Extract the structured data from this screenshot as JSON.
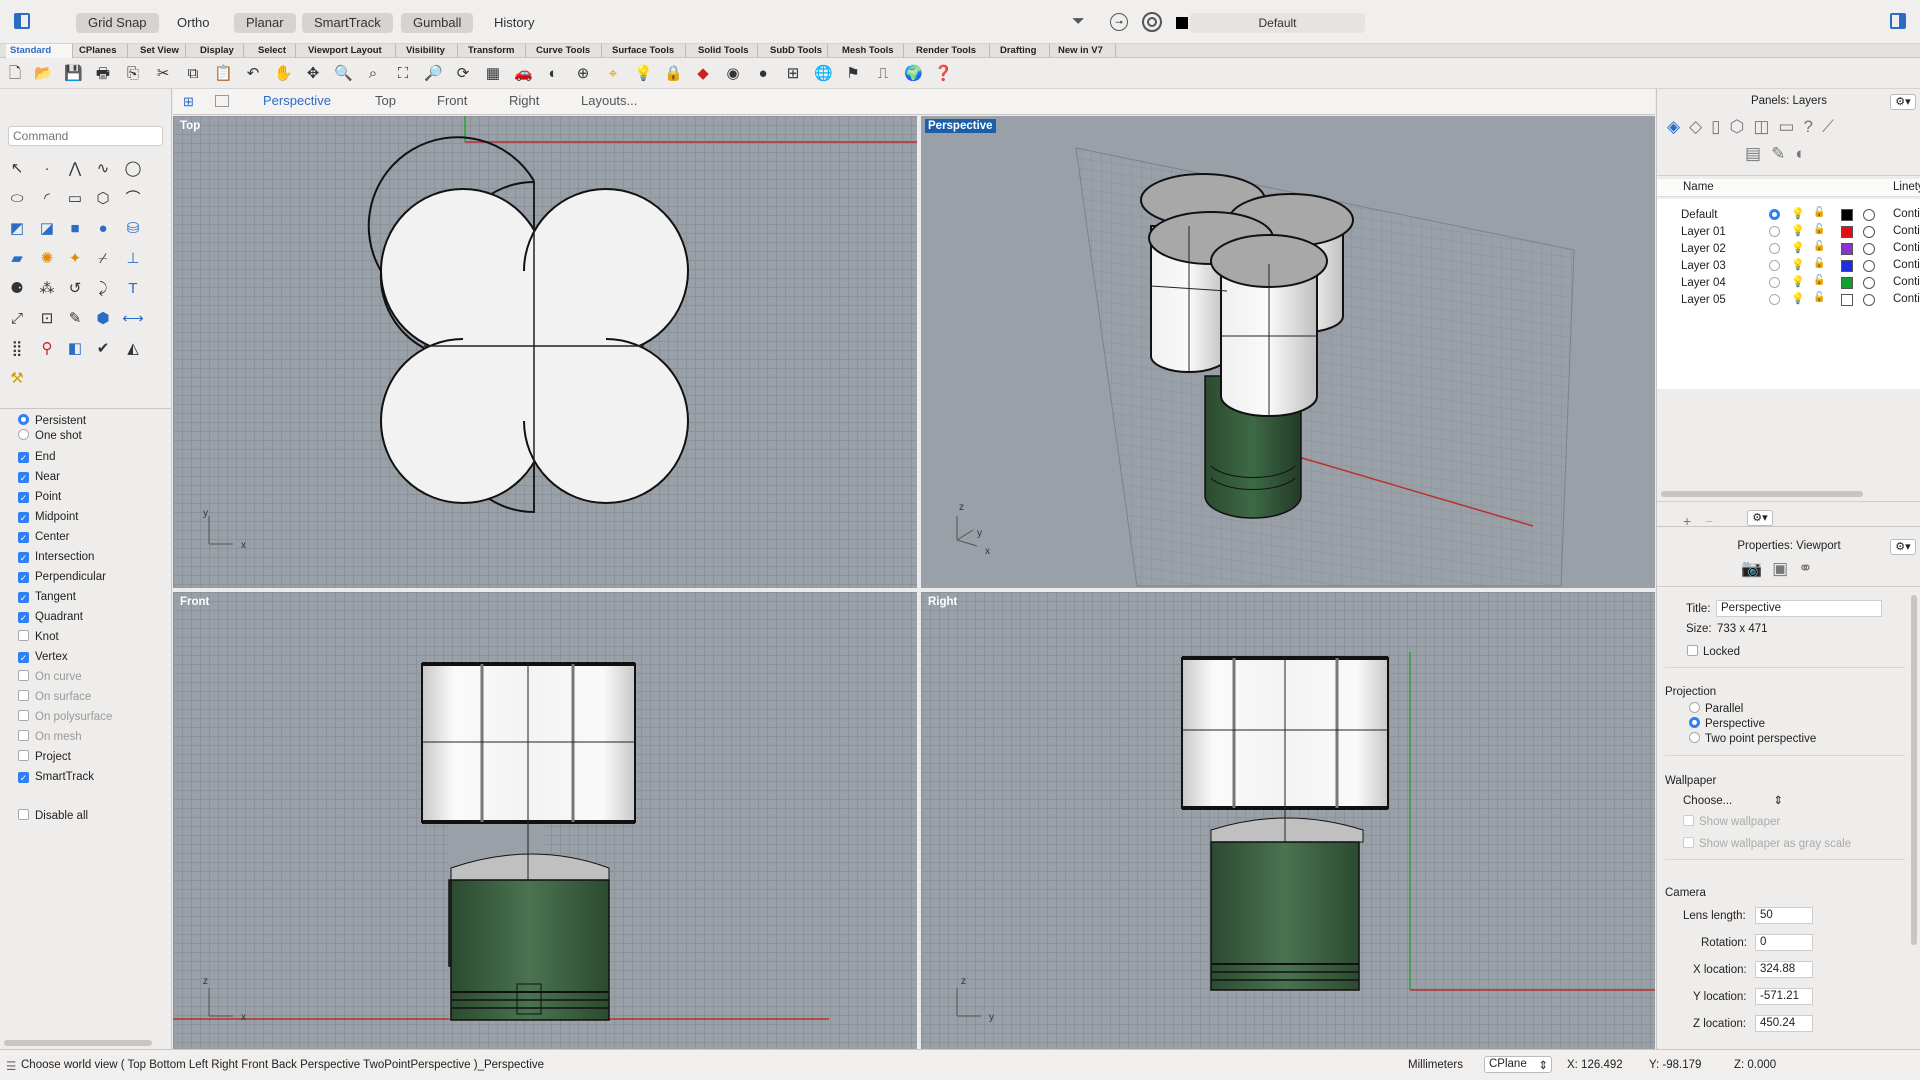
{
  "toolbar": {
    "grid_snap": "Grid Snap",
    "ortho": "Ortho",
    "planar": "Planar",
    "smarttrack": "SmartTrack",
    "gumball": "Gumball",
    "history": "History",
    "current_layer": "Default"
  },
  "tabs": [
    "Standard",
    "CPlanes",
    "Set View",
    "Display",
    "Select",
    "Viewport Layout",
    "Visibility",
    "Transform",
    "Curve Tools",
    "Surface Tools",
    "Solid Tools",
    "SubD Tools",
    "Mesh Tools",
    "Render Tools",
    "Drafting",
    "New in V7"
  ],
  "command": {
    "placeholder": "Command"
  },
  "viewport_tabs": {
    "perspective": "Perspective",
    "top": "Top",
    "front": "Front",
    "right": "Right",
    "layouts": "Layouts..."
  },
  "viewports": {
    "top": "Top",
    "perspective": "Perspective",
    "front": "Front",
    "right": "Right"
  },
  "axes": {
    "x": "x",
    "y": "y",
    "z": "z"
  },
  "osnap": {
    "persistent": "Persistent",
    "one_shot": "One shot",
    "items": [
      {
        "label": "End",
        "checked": true
      },
      {
        "label": "Near",
        "checked": true
      },
      {
        "label": "Point",
        "checked": true
      },
      {
        "label": "Midpoint",
        "checked": true
      },
      {
        "label": "Center",
        "checked": true
      },
      {
        "label": "Intersection",
        "checked": true
      },
      {
        "label": "Perpendicular",
        "checked": true
      },
      {
        "label": "Tangent",
        "checked": true
      },
      {
        "label": "Quadrant",
        "checked": true
      },
      {
        "label": "Knot",
        "checked": false
      },
      {
        "label": "Vertex",
        "checked": true
      },
      {
        "label": "On curve",
        "checked": false
      },
      {
        "label": "On surface",
        "checked": false
      },
      {
        "label": "On polysurface",
        "checked": false
      },
      {
        "label": "On mesh",
        "checked": false
      },
      {
        "label": "Project",
        "checked": false
      },
      {
        "label": "SmartTrack",
        "checked": true
      }
    ],
    "disable_all": "Disable all"
  },
  "layers_panel": {
    "title": "Panels: Layers",
    "col_name": "Name",
    "col_linetype": "Linety",
    "layers": [
      {
        "name": "Default",
        "color": "#000000",
        "current": true,
        "linetype": "Conti"
      },
      {
        "name": "Layer 01",
        "color": "#e01010",
        "current": false,
        "linetype": "Conti"
      },
      {
        "name": "Layer 02",
        "color": "#8a35c9",
        "current": false,
        "linetype": "Conti"
      },
      {
        "name": "Layer 03",
        "color": "#1a2fe0",
        "current": false,
        "linetype": "Conti"
      },
      {
        "name": "Layer 04",
        "color": "#10a030",
        "current": false,
        "linetype": "Conti"
      },
      {
        "name": "Layer 05",
        "color": "#ffffff",
        "current": false,
        "linetype": "Conti"
      }
    ]
  },
  "properties_panel": {
    "title": "Properties: Viewport",
    "title_label": "Title:",
    "title_value": "Perspective",
    "size_label": "Size:",
    "size_value": "733 x 471",
    "locked": "Locked",
    "projection": "Projection",
    "parallel": "Parallel",
    "perspective": "Perspective",
    "two_point": "Two point perspective",
    "wallpaper": "Wallpaper",
    "choose": "Choose...",
    "show_wallpaper": "Show wallpaper",
    "show_gray": "Show wallpaper as gray scale",
    "camera": "Camera",
    "lens_label": "Lens length:",
    "lens_value": "50",
    "rotation_label": "Rotation:",
    "rotation_value": "0",
    "xloc_label": "X location:",
    "xloc_value": "324.88",
    "yloc_label": "Y location:",
    "yloc_value": "-571.21",
    "zloc_label": "Z location:",
    "zloc_value": "450.24"
  },
  "status": {
    "prompt": "Choose world view ( Top Bottom Left Right Front Back Perspective TwoPointPerspective )_Perspective",
    "units": "Millimeters",
    "cplane": "CPlane",
    "x": "X: 126.492",
    "y": "Y: -98.179",
    "z": "Z: 0.000"
  },
  "colors": {
    "accent": "#2f7ff6",
    "viewport_bg": "#9aa0a7",
    "active_title": "#1c5fa8",
    "green_body": "#35573a"
  }
}
